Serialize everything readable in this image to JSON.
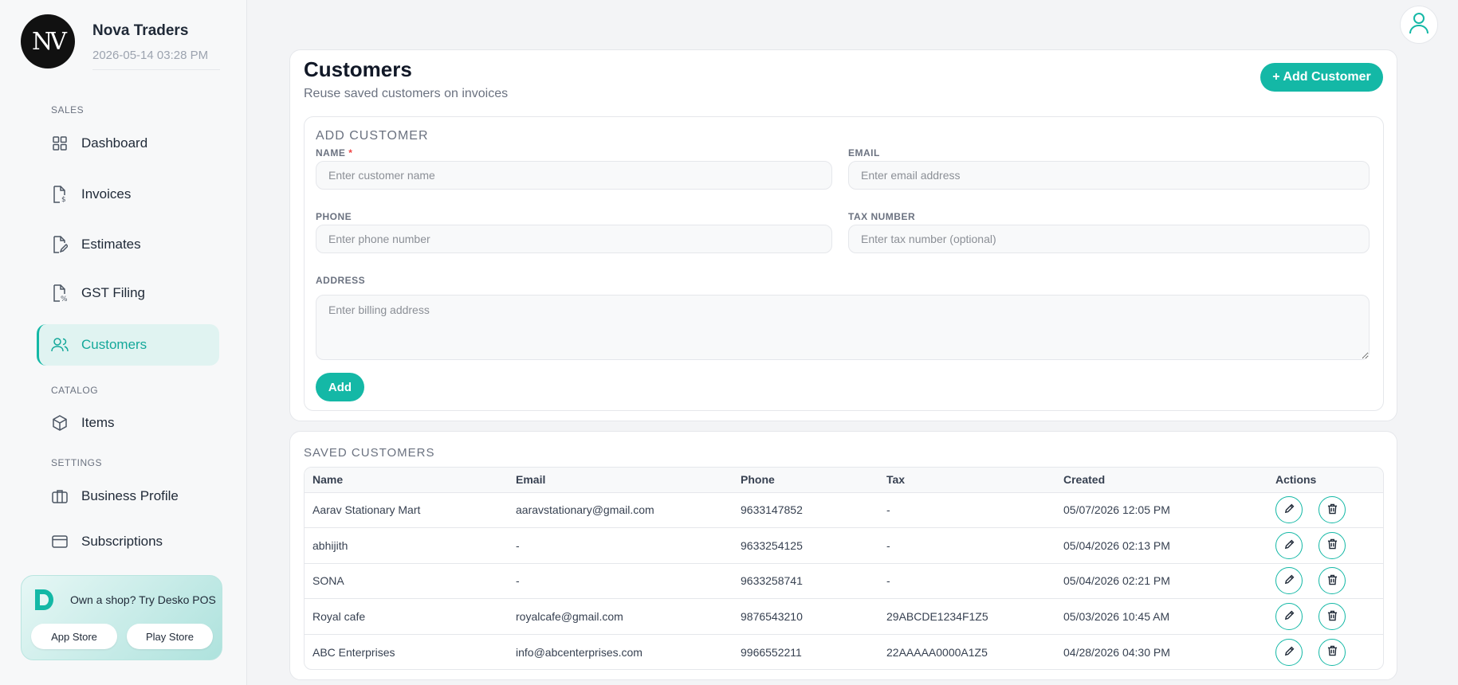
{
  "brand": {
    "logo_text": "NV",
    "name": "Nova Traders",
    "datetime": "2026-05-14 03:28 PM"
  },
  "sidebar": {
    "sections": [
      {
        "label": "SALES"
      },
      {
        "label": "CATALOG"
      },
      {
        "label": "SETTINGS"
      }
    ],
    "items": [
      {
        "label": "Dashboard",
        "icon": "grid-icon"
      },
      {
        "label": "Invoices",
        "icon": "invoice-icon"
      },
      {
        "label": "Estimates",
        "icon": "estimate-icon"
      },
      {
        "label": "GST Filing",
        "icon": "gst-icon"
      },
      {
        "label": "Customers",
        "icon": "users-icon",
        "active": true
      },
      {
        "label": "Items",
        "icon": "box-icon"
      },
      {
        "label": "Business Profile",
        "icon": "briefcase-icon"
      },
      {
        "label": "Subscriptions",
        "icon": "card-icon"
      }
    ],
    "promo": {
      "text": "Own a shop? Try Desko POS",
      "app_store": "App Store",
      "play_store": "Play Store"
    }
  },
  "page": {
    "title": "Customers",
    "subtitle": "Reuse saved customers on invoices",
    "add_customer_label": "+ Add Customer"
  },
  "form": {
    "title": "ADD CUSTOMER",
    "name_label": "NAME",
    "name_required": "*",
    "name_placeholder": "Enter customer name",
    "email_label": "EMAIL",
    "email_placeholder": "Enter email address",
    "phone_label": "PHONE",
    "phone_placeholder": "Enter phone number",
    "tax_label": "TAX NUMBER",
    "tax_placeholder": "Enter tax number (optional)",
    "address_label": "ADDRESS",
    "address_placeholder": "Enter billing address",
    "submit_label": "Add"
  },
  "saved": {
    "title": "SAVED CUSTOMERS",
    "columns": [
      "Name",
      "Email",
      "Phone",
      "Tax",
      "Created",
      "Actions"
    ],
    "rows": [
      [
        "Aarav Stationary Mart",
        "aaravstationary@gmail.com",
        "9633147852",
        "-",
        "05/07/2026 12:05 PM"
      ],
      [
        "abhijith",
        "-",
        "9633254125",
        "-",
        "05/04/2026 02:13 PM"
      ],
      [
        "SONA",
        "-",
        "9633258741",
        "-",
        "05/04/2026 02:21 PM"
      ],
      [
        "Royal cafe",
        "royalcafe@gmail.com",
        "9876543210",
        "29ABCDE1234F1Z5",
        "05/03/2026 10:45 AM"
      ],
      [
        "ABC Enterprises",
        "info@abcenterprises.com",
        "9966552211",
        "22AAAAA0000A1Z5",
        "04/28/2026 04:30 PM"
      ]
    ]
  },
  "colors": {
    "accent": "#14b8a6",
    "active_bg": "#e0f3f1",
    "required": "#ef4444"
  }
}
